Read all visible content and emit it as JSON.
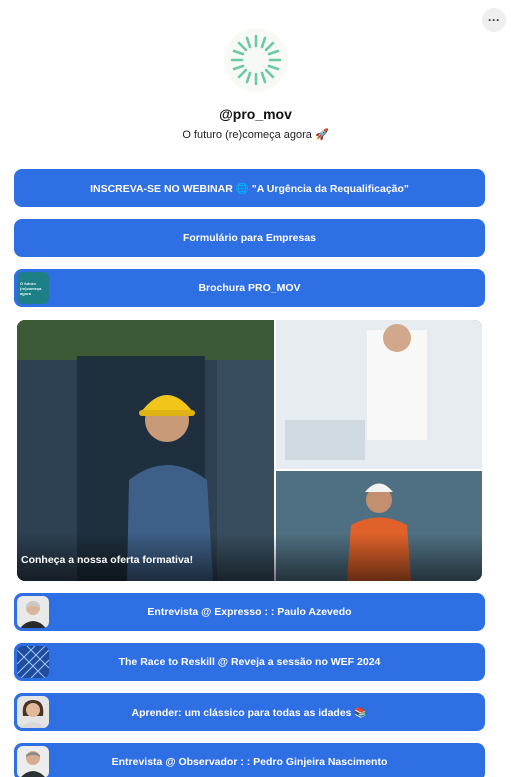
{
  "profile": {
    "handle": "@pro_mov",
    "tagline": "O futuro (re)começa agora 🚀"
  },
  "menu": {
    "more_label": "···"
  },
  "links": [
    {
      "label": "INSCREVA-SE NO WEBINAR 🌐 \"A Urgência da Requalificação\"",
      "icon": "none"
    },
    {
      "label": "Formulário para Empresas",
      "icon": "none"
    },
    {
      "label": "Brochura PRO_MOV",
      "icon": "brochure-thumbnail",
      "thumb_text": "O futuro (re)começa agora"
    }
  ],
  "featured": {
    "caption": "Conheça a nossa oferta formativa!"
  },
  "links_bottom": [
    {
      "label": "Entrevista @ Expresso : : Paulo Azevedo",
      "icon": "person-thumbnail"
    },
    {
      "label": "The Race to Reskill @ Reveja a sessão no WEF 2024",
      "icon": "building-thumbnail"
    },
    {
      "label": "Aprender: um clássico para todas as idades 📚",
      "icon": "person-thumbnail"
    },
    {
      "label": "Entrevista @ Observador : : Pedro Ginjeira Nascimento",
      "icon": "person-thumbnail"
    }
  ],
  "colors": {
    "button": "#2f6fe4",
    "logo": "#6cc9a0"
  }
}
